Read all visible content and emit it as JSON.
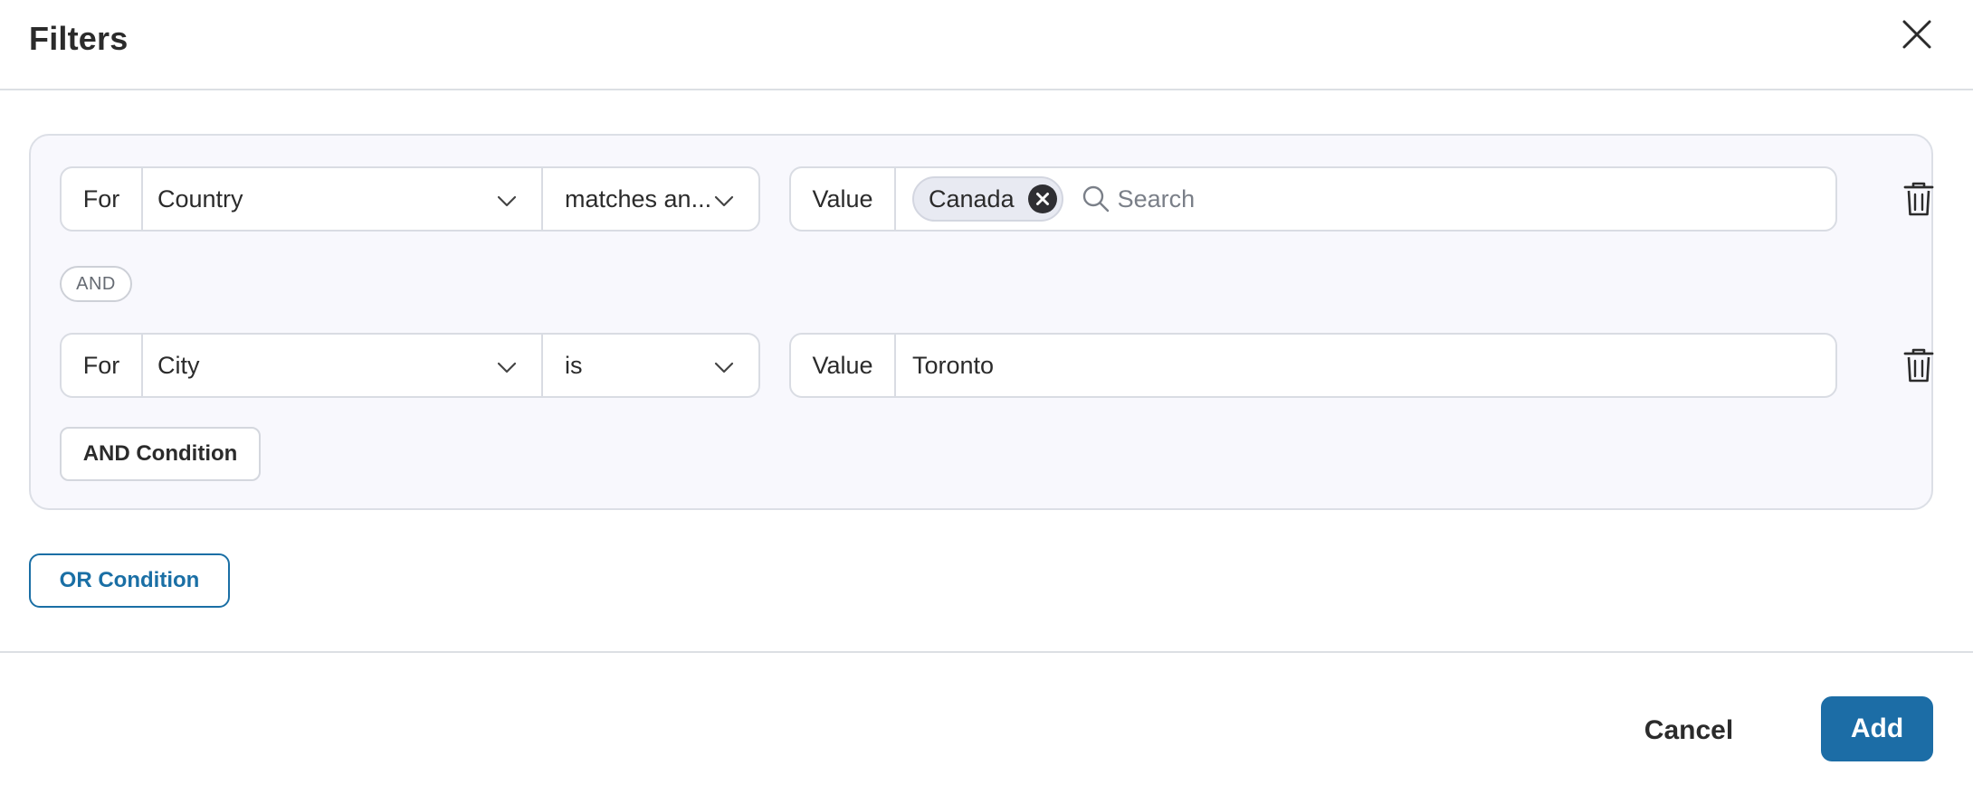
{
  "dialog": {
    "title": "Filters"
  },
  "group": {
    "conditions": [
      {
        "for_label": "For",
        "field": "Country",
        "operator": "matches an...",
        "value_label": "Value",
        "chips": [
          "Canada"
        ],
        "search_placeholder": "Search"
      },
      {
        "for_label": "For",
        "field": "City",
        "operator": "is",
        "value_label": "Value",
        "value": "Toronto"
      }
    ],
    "joiner": "AND",
    "and_button": "AND Condition"
  },
  "or_button": "OR Condition",
  "footer": {
    "cancel": "Cancel",
    "add": "Add"
  },
  "colors": {
    "primary": "#1c6da6",
    "group_bg": "#f8f8fd",
    "border": "#d9dce3"
  }
}
